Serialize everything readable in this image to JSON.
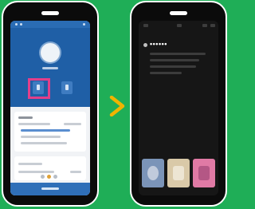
{
  "left_phone": {
    "description_state": "app-profile-screen"
  },
  "arrow": {
    "color": "#f0b400"
  },
  "right_phone": {
    "sender_text": "••••••"
  },
  "colors": {
    "background": "#1fae57",
    "app_blue": "#1f5fa6",
    "highlight": "#e23f8a",
    "arrow": "#f0b400"
  },
  "icons": [
    "chevron-right-icon"
  ]
}
